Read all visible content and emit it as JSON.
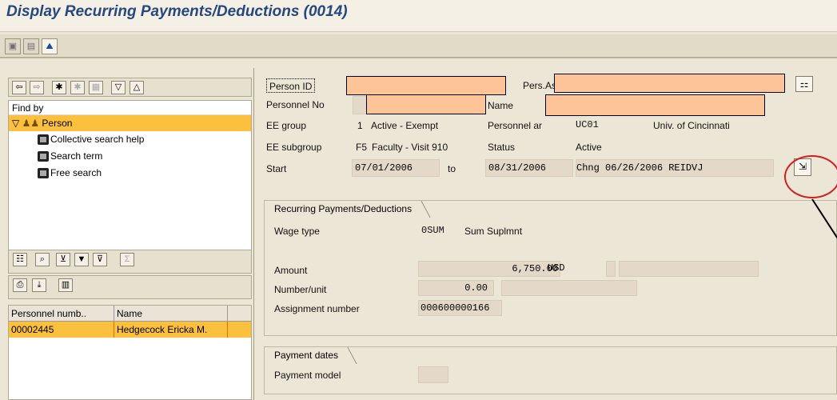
{
  "app": {
    "title": "Display Recurring Payments/Deductions (0014)"
  },
  "left": {
    "find_by_label": "Find by",
    "person_label": "Person",
    "tree_items": [
      "Collective search help",
      "Search term",
      "Free search"
    ],
    "table_headers": [
      "Personnel numb..",
      "Name"
    ],
    "table_rows": [
      {
        "number": "00002445",
        "name": "Hedgecock Ericka M."
      }
    ]
  },
  "header": {
    "person_id_label": "Person ID",
    "pers_ass_label": "Pers.Ass",
    "personnel_no_label": "Personnel No",
    "name_label": "Name",
    "ee_group_label": "EE group",
    "ee_group_code": "1",
    "ee_group_text": "Active - Exempt",
    "personnel_area_label": "Personnel ar",
    "personnel_area_code": "UC01",
    "personnel_area_text": "Univ. of Cincinnati",
    "ee_subgroup_label": "EE subgroup",
    "ee_subgroup_code": "F5",
    "ee_subgroup_text": "Faculty - Visit 910",
    "status_label": "Status",
    "status_value": "Active",
    "start_label": "Start",
    "start_value": "07/01/2006",
    "to_label": "to",
    "end_value": "08/31/2006",
    "change_text": "Chng 06/26/2006 REIDVJ"
  },
  "recurring": {
    "title": "Recurring Payments/Deductions",
    "wage_type_label": "Wage type",
    "wage_type_code": "0SUM",
    "wage_type_text": "Sum Suplmnt",
    "amount_label": "Amount",
    "amount_value": "6,750.00",
    "currency": "USD",
    "number_unit_label": "Number/unit",
    "number_unit_value": "0.00",
    "assignment_label": "Assignment number",
    "assignment_value": "000600000166"
  },
  "payment_dates": {
    "title": "Payment dates",
    "model_label": "Payment model"
  }
}
